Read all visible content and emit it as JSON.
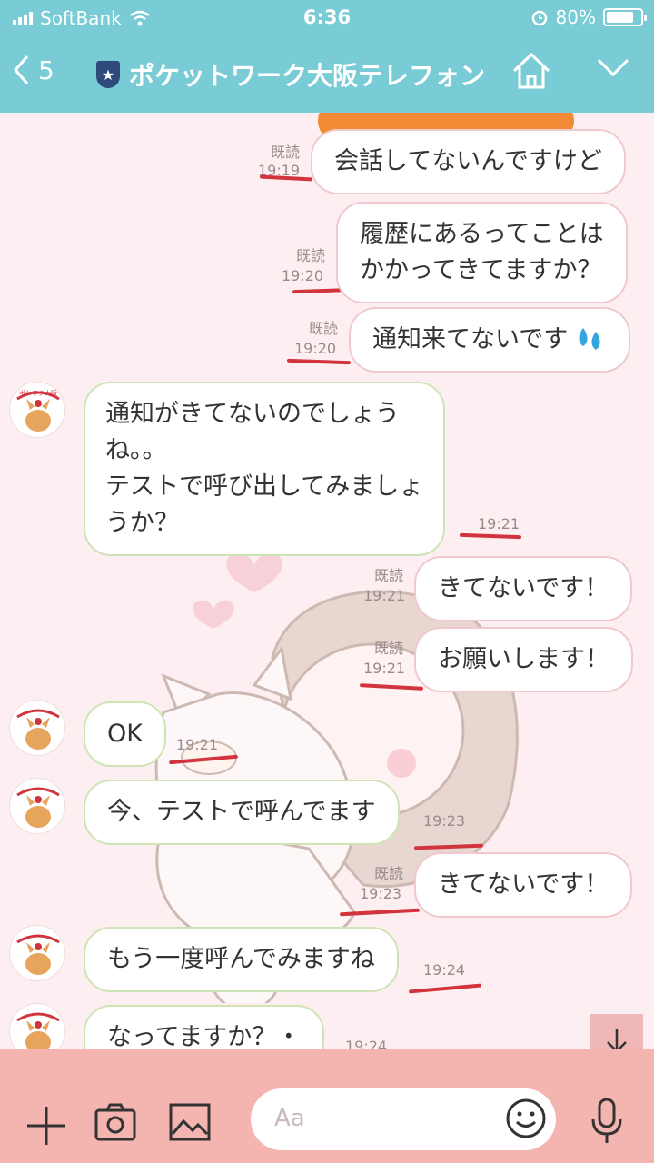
{
  "status": {
    "carrier": "SoftBank",
    "time": "6:36",
    "battery": "80%",
    "battery_level": 0.8
  },
  "header": {
    "back_count": "5",
    "title": "ポケットワーク大阪テレフォン",
    "shield_glyph": "★"
  },
  "messages": [
    {
      "dir": "out",
      "text": "会話してないんですけど",
      "read": "既読",
      "time": "19:19"
    },
    {
      "dir": "out",
      "lines": [
        "履歴にあるってことは",
        "かかってきてますか？"
      ],
      "read": "既読",
      "time": "19:20"
    },
    {
      "dir": "out",
      "text": "通知来てないです",
      "emoji": "💦",
      "read": "既読",
      "time": "19:20"
    },
    {
      "dir": "in",
      "lines": [
        "通知がきてないのでしょう",
        "ね。。",
        "テストで呼び出してみましょ",
        "うか？"
      ],
      "time": "19:21"
    },
    {
      "dir": "out",
      "text": "きてないです！",
      "read": "既読",
      "time": "19:21"
    },
    {
      "dir": "out",
      "text": "お願いします！",
      "read": "既読",
      "time": "19:21"
    },
    {
      "dir": "in",
      "text": "OK",
      "time": "19:21"
    },
    {
      "dir": "in",
      "text": "今、テストで呼んでます",
      "time": "19:23"
    },
    {
      "dir": "out",
      "text": "きてないです！",
      "read": "既読",
      "time": "19:23"
    },
    {
      "dir": "in",
      "text": "もう一度呼んでみますね",
      "time": "19:24"
    },
    {
      "dir": "in",
      "text": "なってますか？・",
      "time": "19:24"
    }
  ],
  "avatar": {
    "logo_text": "ポケワク大阪"
  },
  "input": {
    "placeholder": "Aa"
  },
  "icons": [
    "signal-icon",
    "wifi-icon",
    "alarm-icon",
    "battery-icon",
    "back-chevron-icon",
    "shield-icon",
    "home-icon",
    "chevron-down-icon",
    "plus-icon",
    "camera-icon",
    "image-icon",
    "smile-icon",
    "mic-icon",
    "arrow-down-icon"
  ],
  "colors": {
    "header": "#79ccd5",
    "background": "#fdeff1",
    "input_bar": "#f4b4b0",
    "out_border": "#f0c9cf",
    "in_border": "#cfe4b5"
  }
}
